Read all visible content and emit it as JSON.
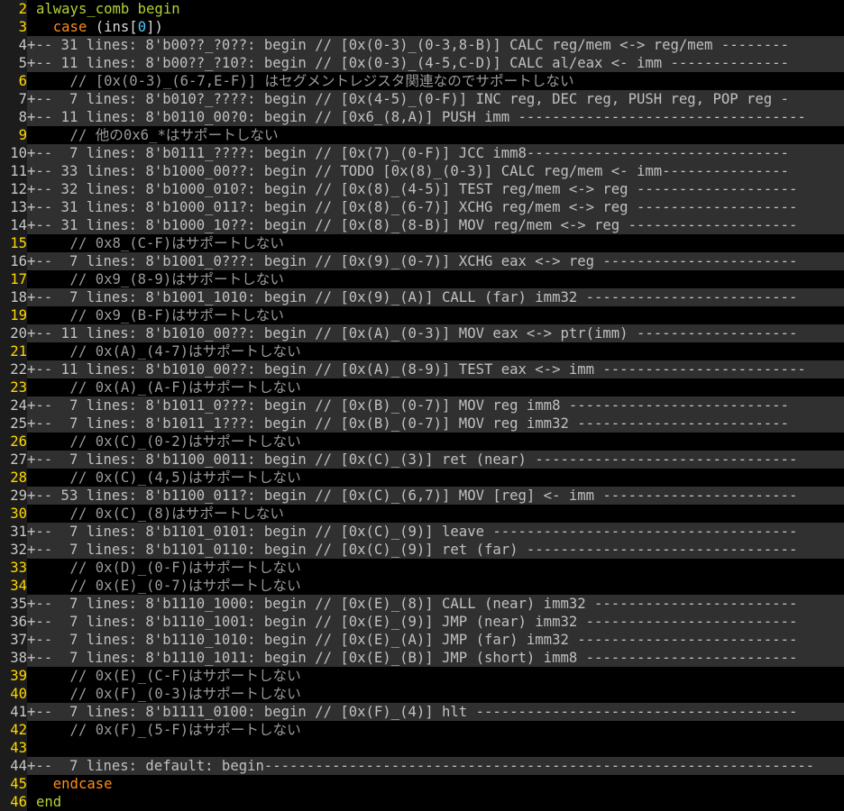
{
  "lines": [
    {
      "n": "2",
      "type": "code",
      "parts": [
        {
          "c": "kw",
          "t": "always_comb begin"
        }
      ]
    },
    {
      "n": "3",
      "type": "code",
      "parts": [
        {
          "c": "plain",
          "t": "  "
        },
        {
          "c": "kw2",
          "t": "case"
        },
        {
          "c": "plain",
          "t": " (ins["
        },
        {
          "c": "num",
          "t": "0"
        },
        {
          "c": "plain",
          "t": "])"
        }
      ]
    },
    {
      "n": "4",
      "type": "fold",
      "text": "+-- 31 lines: 8'b00??_?0??: begin // [0x(0-3)_(0-3,8-B)] CALC reg/mem <-> reg/mem --------"
    },
    {
      "n": "5",
      "type": "fold",
      "text": "+-- 11 lines: 8'b00??_?10?: begin // [0x(0-3)_(4-5,C-D)] CALC al/eax <- imm --------------"
    },
    {
      "n": "6",
      "type": "code",
      "parts": [
        {
          "c": "cm",
          "t": "    // [0x(0-3)_(6-7,E-F)] はセグメントレジスタ関連なのでサポートしない"
        }
      ]
    },
    {
      "n": "7",
      "type": "fold",
      "text": "+--  7 lines: 8'b010?_????: begin // [0x(4-5)_(0-F)] INC reg, DEC reg, PUSH reg, POP reg -"
    },
    {
      "n": "8",
      "type": "fold",
      "text": "+-- 11 lines: 8'b0110_00?0: begin // [0x6_(8,A)] PUSH imm ----------------------------------"
    },
    {
      "n": "9",
      "type": "code",
      "parts": [
        {
          "c": "cm",
          "t": "    // 他の0x6_*はサポートしない"
        }
      ]
    },
    {
      "n": "10",
      "type": "fold",
      "text": "+--  7 lines: 8'b0111_????: begin // [0x(7)_(0-F)] JCC imm8-------------------------------"
    },
    {
      "n": "11",
      "type": "fold",
      "text": "+-- 33 lines: 8'b1000_00??: begin // TODO [0x(8)_(0-3)] CALC reg/mem <- imm---------------"
    },
    {
      "n": "12",
      "type": "fold",
      "text": "+-- 32 lines: 8'b1000_010?: begin // [0x(8)_(4-5)] TEST reg/mem <-> reg -------------------"
    },
    {
      "n": "13",
      "type": "fold",
      "text": "+-- 31 lines: 8'b1000_011?: begin // [0x(8)_(6-7)] XCHG reg/mem <-> reg -------------------"
    },
    {
      "n": "14",
      "type": "fold",
      "text": "+-- 31 lines: 8'b1000_10??: begin // [0x(8)_(8-B)] MOV reg/mem <-> reg --------------------"
    },
    {
      "n": "15",
      "type": "code",
      "parts": [
        {
          "c": "cm",
          "t": "    // 0x8_(C-F)はサポートしない"
        }
      ]
    },
    {
      "n": "16",
      "type": "fold",
      "text": "+--  7 lines: 8'b1001_0???: begin // [0x(9)_(0-7)] XCHG eax <-> reg -----------------------"
    },
    {
      "n": "17",
      "type": "code",
      "parts": [
        {
          "c": "cm",
          "t": "    // 0x9_(8-9)はサポートしない"
        }
      ]
    },
    {
      "n": "18",
      "type": "fold",
      "text": "+--  7 lines: 8'b1001_1010: begin // [0x(9)_(A)] CALL (far) imm32 -------------------------"
    },
    {
      "n": "19",
      "type": "code",
      "parts": [
        {
          "c": "cm",
          "t": "    // 0x9_(B-F)はサポートしない"
        }
      ]
    },
    {
      "n": "20",
      "type": "fold",
      "text": "+-- 11 lines: 8'b1010_00??: begin // [0x(A)_(0-3)] MOV eax <-> ptr(imm) -------------------"
    },
    {
      "n": "21",
      "type": "code",
      "parts": [
        {
          "c": "cm",
          "t": "    // 0x(A)_(4-7)はサポートしない"
        }
      ]
    },
    {
      "n": "22",
      "type": "fold",
      "text": "+-- 11 lines: 8'b1010_00??: begin // [0x(A)_(8-9)] TEST eax <-> imm ------------------------"
    },
    {
      "n": "23",
      "type": "code",
      "parts": [
        {
          "c": "cm",
          "t": "    // 0x(A)_(A-F)はサポートしない"
        }
      ]
    },
    {
      "n": "24",
      "type": "fold",
      "text": "+--  7 lines: 8'b1011_0???: begin // [0x(B)_(0-7)] MOV reg imm8 --------------------------"
    },
    {
      "n": "25",
      "type": "fold",
      "text": "+--  7 lines: 8'b1011_1???: begin // [0x(B)_(0-7)] MOV reg imm32 -------------------------"
    },
    {
      "n": "26",
      "type": "code",
      "parts": [
        {
          "c": "cm",
          "t": "    // 0x(C)_(0-2)はサポートしない"
        }
      ]
    },
    {
      "n": "27",
      "type": "fold",
      "text": "+--  7 lines: 8'b1100_0011: begin // [0x(C)_(3)] ret (near) -------------------------------"
    },
    {
      "n": "28",
      "type": "code",
      "parts": [
        {
          "c": "cm",
          "t": "    // 0x(C)_(4,5)はサポートしない"
        }
      ]
    },
    {
      "n": "29",
      "type": "fold",
      "text": "+-- 53 lines: 8'b1100_011?: begin // [0x(C)_(6,7)] MOV [reg] <- imm -----------------------"
    },
    {
      "n": "30",
      "type": "code",
      "parts": [
        {
          "c": "cm",
          "t": "    // 0x(C)_(8)はサポートしない"
        }
      ]
    },
    {
      "n": "31",
      "type": "fold",
      "text": "+--  7 lines: 8'b1101_0101: begin // [0x(C)_(9)] leave ------------------------------------"
    },
    {
      "n": "32",
      "type": "fold",
      "text": "+--  7 lines: 8'b1101_0110: begin // [0x(C)_(9)] ret (far) --------------------------------"
    },
    {
      "n": "33",
      "type": "code",
      "parts": [
        {
          "c": "cm",
          "t": "    // 0x(D)_(0-F)はサポートしない"
        }
      ]
    },
    {
      "n": "34",
      "type": "code",
      "parts": [
        {
          "c": "cm",
          "t": "    // 0x(E)_(0-7)はサポートしない"
        }
      ]
    },
    {
      "n": "35",
      "type": "fold",
      "text": "+--  7 lines: 8'b1110_1000: begin // [0x(E)_(8)] CALL (near) imm32 ------------------------"
    },
    {
      "n": "36",
      "type": "fold",
      "text": "+--  7 lines: 8'b1110_1001: begin // [0x(E)_(9)] JMP (near) imm32 -------------------------"
    },
    {
      "n": "37",
      "type": "fold",
      "text": "+--  7 lines: 8'b1110_1010: begin // [0x(E)_(A)] JMP (far) imm32 --------------------------"
    },
    {
      "n": "38",
      "type": "fold",
      "text": "+--  7 lines: 8'b1110_1011: begin // [0x(E)_(B)] JMP (short) imm8 -------------------------"
    },
    {
      "n": "39",
      "type": "code",
      "parts": [
        {
          "c": "cm",
          "t": "    // 0x(E)_(C-F)はサポートしない"
        }
      ]
    },
    {
      "n": "40",
      "type": "code",
      "parts": [
        {
          "c": "cm",
          "t": "    // 0x(F)_(0-3)はサポートしない"
        }
      ]
    },
    {
      "n": "41",
      "type": "fold",
      "text": "+--  7 lines: 8'b1111_0100: begin // [0x(F)_(4)] hlt --------------------------------------"
    },
    {
      "n": "42",
      "type": "code",
      "parts": [
        {
          "c": "cm",
          "t": "    // 0x(F)_(5-F)はサポートしない"
        }
      ]
    },
    {
      "n": "43",
      "type": "code",
      "parts": [
        {
          "c": "plain",
          "t": ""
        }
      ]
    },
    {
      "n": "44",
      "type": "fold",
      "text": "+--  7 lines: default: begin-----------------------------------------------------------------"
    },
    {
      "n": "45",
      "type": "code",
      "parts": [
        {
          "c": "plain",
          "t": "  "
        },
        {
          "c": "kw2",
          "t": "endcase"
        }
      ]
    },
    {
      "n": "46",
      "type": "code",
      "parts": [
        {
          "c": "kw",
          "t": "end"
        }
      ]
    }
  ]
}
